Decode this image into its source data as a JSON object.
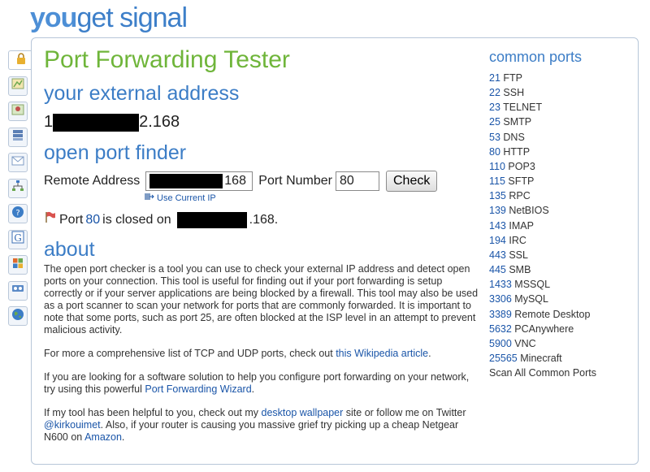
{
  "logo": {
    "you": "you",
    "rest": "get signal"
  },
  "page_title": "Port Forwarding Tester",
  "external": {
    "heading": "your external address",
    "ip_prefix": "1",
    "ip_suffix": "2.168"
  },
  "finder": {
    "heading": "open port finder",
    "remote_label": "Remote Address",
    "remote_suffix": "168",
    "port_label": "Port Number",
    "port_value": "80",
    "check_label": "Check",
    "use_ip_label": "Use Current IP"
  },
  "result": {
    "prefix": "Port",
    "port": "80",
    "middle": "is closed on",
    "suffix": ".168."
  },
  "about": {
    "heading": "about",
    "p1": "The open port checker is a tool you can use to check your external IP address and detect open ports on your connection. This tool is useful for finding out if your port forwarding is setup correctly or if your server applications are being blocked by a firewall. This tool may also be used as a port scanner to scan your network for ports that are commonly forwarded. It is important to note that some ports, such as port 25, are often blocked at the ISP level in an attempt to prevent malicious activity.",
    "p2_text": "For more a comprehensive list of TCP and UDP ports, check out",
    "p2_link": "this Wikipedia article",
    "p2_end": ".",
    "p3_text": "If you are looking for a software solution to help you configure port forwarding on your network, try using this powerful",
    "p3_link": "Port Forwarding Wizard",
    "p3_end": ".",
    "p4_a": "If my tool has been helpful to you, check out my",
    "p4_link1": "desktop wallpaper",
    "p4_b": "site or follow me on Twitter",
    "p4_link2": "@kirkouimet",
    "p4_c": ". Also, if your router is causing you massive grief try picking up a cheap Netgear N600 on",
    "p4_link3": "Amazon",
    "p4_d": "."
  },
  "common_ports": {
    "title": "common ports",
    "items": [
      {
        "num": "21",
        "name": "FTP"
      },
      {
        "num": "22",
        "name": "SSH"
      },
      {
        "num": "23",
        "name": "TELNET"
      },
      {
        "num": "25",
        "name": "SMTP"
      },
      {
        "num": "53",
        "name": "DNS"
      },
      {
        "num": "80",
        "name": "HTTP"
      },
      {
        "num": "110",
        "name": "POP3"
      },
      {
        "num": "115",
        "name": "SFTP"
      },
      {
        "num": "135",
        "name": "RPC"
      },
      {
        "num": "139",
        "name": "NetBIOS"
      },
      {
        "num": "143",
        "name": "IMAP"
      },
      {
        "num": "194",
        "name": "IRC"
      },
      {
        "num": "443",
        "name": "SSL"
      },
      {
        "num": "445",
        "name": "SMB"
      },
      {
        "num": "1433",
        "name": "MSSQL"
      },
      {
        "num": "3306",
        "name": "MySQL"
      },
      {
        "num": "3389",
        "name": "Remote Desktop"
      },
      {
        "num": "5632",
        "name": "PCAnywhere"
      },
      {
        "num": "5900",
        "name": "VNC"
      },
      {
        "num": "25565",
        "name": "Minecraft"
      }
    ],
    "scan_all": "Scan All Common Ports"
  },
  "tools": [
    {
      "icon": "lock-icon",
      "color": "#e8b030"
    },
    {
      "icon": "map-icon",
      "color": "#6aa84f"
    },
    {
      "icon": "map-pin-icon",
      "color": "#c0504d"
    },
    {
      "icon": "server-icon",
      "color": "#5b7fb5"
    },
    {
      "icon": "email-icon",
      "color": "#7f9cc5"
    },
    {
      "icon": "network-icon",
      "color": "#3d78c4"
    },
    {
      "icon": "help-icon",
      "color": "#3c7dc6"
    },
    {
      "icon": "google-icon",
      "color": "#3c6fb5"
    },
    {
      "icon": "windows-icon",
      "color": "#e06a2b"
    },
    {
      "icon": "media-icon",
      "color": "#5a8ac7"
    },
    {
      "icon": "globe-icon",
      "color": "#4a9f4a"
    }
  ],
  "colors": {
    "accent_green": "#6fb53a",
    "accent_blue": "#3c7dc6",
    "link": "#1a55a8"
  }
}
